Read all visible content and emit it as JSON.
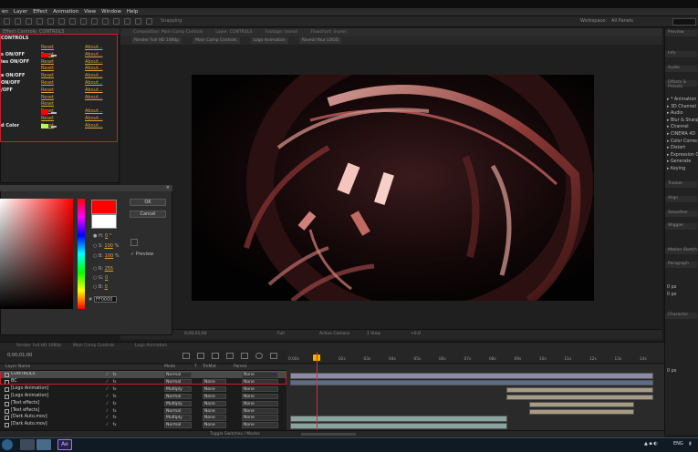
{
  "menubar": {
    "items": [
      "en",
      "Layer",
      "Effect",
      "Animation",
      "View",
      "Window",
      "Help"
    ]
  },
  "toolbar": {
    "snapping": "Snapping",
    "workspace_label": "Workspace:",
    "workspace_value": "All Panels"
  },
  "effects_panel": {
    "tab_label": "Effect Controls: CONTROLS",
    "section_title": "CONTROLS",
    "rows": [
      {
        "label": "",
        "reset": "Reset",
        "about": "About...",
        "swatch": "#ff0000"
      },
      {
        "label": "s ON/OFF",
        "reset": "Reset",
        "about": "About...",
        "swatch": null
      },
      {
        "label": "ies ON/OFF",
        "reset": "Reset",
        "about": "About...",
        "swatch": null
      },
      {
        "label": "",
        "reset": "Reset",
        "about": "About...",
        "swatch": null
      },
      {
        "label": "e ON/OFF",
        "reset": "Reset",
        "about": "About...",
        "swatch": null
      },
      {
        "label": "ON/OFF",
        "reset": "Reset",
        "about": "About...",
        "swatch": null
      },
      {
        "label": "/OFF",
        "reset": "Reset",
        "about": "About...",
        "swatch": null
      },
      {
        "label": "",
        "reset": "Reset",
        "about": "About...",
        "swatch": null
      },
      {
        "label": "",
        "reset": "Reset",
        "about": "",
        "swatch": "#ff0000"
      },
      {
        "label": "",
        "reset": "Reset",
        "about": "About...",
        "swatch": null
      },
      {
        "label": "",
        "reset": "Reset",
        "about": "About...",
        "swatch": "#aaff66"
      },
      {
        "label": "d Color",
        "reset": "Reset",
        "about": "About...",
        "swatch": null
      }
    ]
  },
  "composition": {
    "tabs": [
      "Composition: Main Comp Controls",
      "Layer: CONTROLS",
      "Footage: (none)",
      "Flowchart: (none)"
    ],
    "subtabs": [
      "Render Full HD 1080p",
      "Main Comp Controls",
      "Logo Animation",
      "Reveal Your LOGO"
    ],
    "footer": {
      "zoom": "25%",
      "timecode": "0;00;01;00",
      "resolution": "Full",
      "camera": "Active Camera",
      "views": "1 View",
      "offset": "+0.0"
    }
  },
  "color_dialog": {
    "ok_label": "OK",
    "cancel_label": "Cancel",
    "preview_label": "Preview",
    "h_label": "H:",
    "h_value": "0",
    "h_unit": "°",
    "s_label": "S:",
    "s_value": "100",
    "s_unit": "%",
    "b_label": "B:",
    "b_value": "100",
    "b_unit": "%",
    "r_label": "R:",
    "r_value": "255",
    "g_label": "G:",
    "g_value": "0",
    "bl_label": "B:",
    "bl_value": "0",
    "hex_label": "#",
    "hex_value": "FF0000",
    "new_color": "#ff0000",
    "old_color": "#ffffff"
  },
  "right_panel": {
    "headers": [
      "Preview",
      "Info",
      "Audio",
      "Effects & Presets",
      "Tracker",
      "Align",
      "Smoother",
      "Wiggler",
      "Motion Sketch",
      "Paragraph",
      "Character"
    ],
    "effects_list": [
      "* Animation",
      "3D Channel",
      "Audio",
      "Blur & Sharpen",
      "Channel",
      "CINEMA 4D",
      "Color Correction",
      "Distort",
      "Expression Controls",
      "Generate",
      "Keying"
    ],
    "paragraph_values": [
      "0 px",
      "0 px",
      "0 px"
    ]
  },
  "timeline": {
    "tabs": [
      "Render Full HD 1080p",
      "Main Comp Controls",
      "Logo Animation"
    ],
    "column_headers": {
      "layer_name": "Layer Name",
      "mode": "Mode",
      "trkmat": "TrkMat",
      "parent": "Parent",
      "t": "T"
    },
    "ruler_ticks": [
      "0:00s",
      "01s",
      "02s",
      "03s",
      "04s",
      "05s",
      "06s",
      "07s",
      "08s",
      "09s",
      "10s",
      "11s",
      "12s",
      "13s",
      "14s"
    ],
    "layers": [
      {
        "name": "CONTROLS",
        "mode": "Normal",
        "trkmat": "",
        "parent": "None"
      },
      {
        "name": "BC",
        "mode": "Normal",
        "trkmat": "None",
        "parent": "None"
      },
      {
        "name": "[Logo Animation]",
        "mode": "Multiply",
        "trkmat": "None",
        "parent": "None"
      },
      {
        "name": "[Logo Animation]",
        "mode": "Normal",
        "trkmat": "None",
        "parent": "None"
      },
      {
        "name": "[Text effects]",
        "mode": "Multiply",
        "trkmat": "None",
        "parent": "None"
      },
      {
        "name": "[Text effects]",
        "mode": "Normal",
        "trkmat": "None",
        "parent": "None"
      },
      {
        "name": "[Dark Auto.mov]",
        "mode": "Multiply",
        "trkmat": "None",
        "parent": "None"
      },
      {
        "name": "[Dark Auto.mov]",
        "mode": "Normal",
        "trkmat": "None",
        "parent": "None"
      }
    ],
    "footer": "Toggle Switches / Modes"
  },
  "taskbar": {
    "lang": "ENG",
    "app_label": "Ae"
  },
  "colors": {
    "highlight_red": "#c8202a",
    "link_gold": "#d4a441",
    "playhead": "#d23030",
    "cti": "#f0b000"
  }
}
